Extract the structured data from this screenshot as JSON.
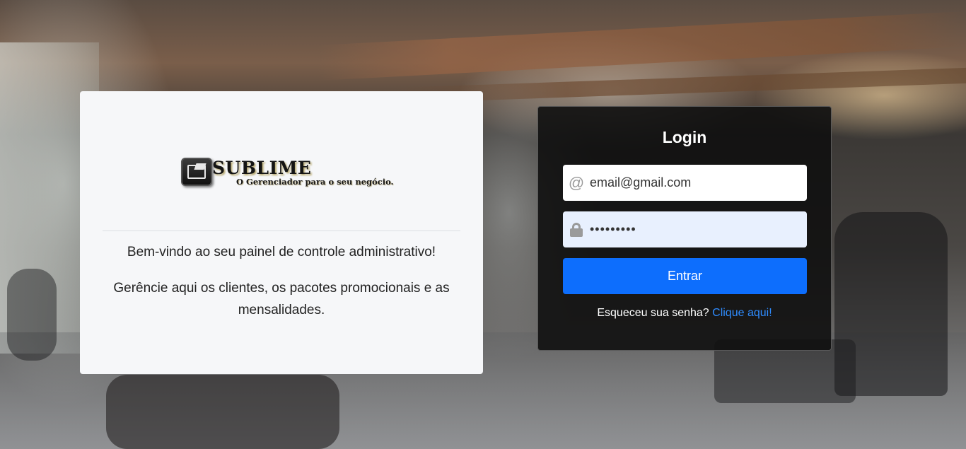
{
  "brand": {
    "name": "SUBLIME",
    "tagline": "O Gerenciador para o seu negócio."
  },
  "info": {
    "welcome": "Bem-vindo ao seu painel de controle administrativo!",
    "description": "Gerêncie aqui os clientes, os pacotes promocionais e as mensalidades."
  },
  "login": {
    "title": "Login",
    "email_value": "email@gmail.com",
    "password_value": "•••••••••",
    "submit_label": "Entrar",
    "forgot_text": "Esqueceu sua senha?",
    "forgot_link": "Clique aqui!"
  },
  "icons": {
    "email": "at-icon",
    "password": "lock-icon"
  },
  "colors": {
    "primary": "#0d6efd",
    "link": "#2f8cff",
    "login_bg": "#0f0f0f",
    "info_bg": "#f6f7f9"
  }
}
